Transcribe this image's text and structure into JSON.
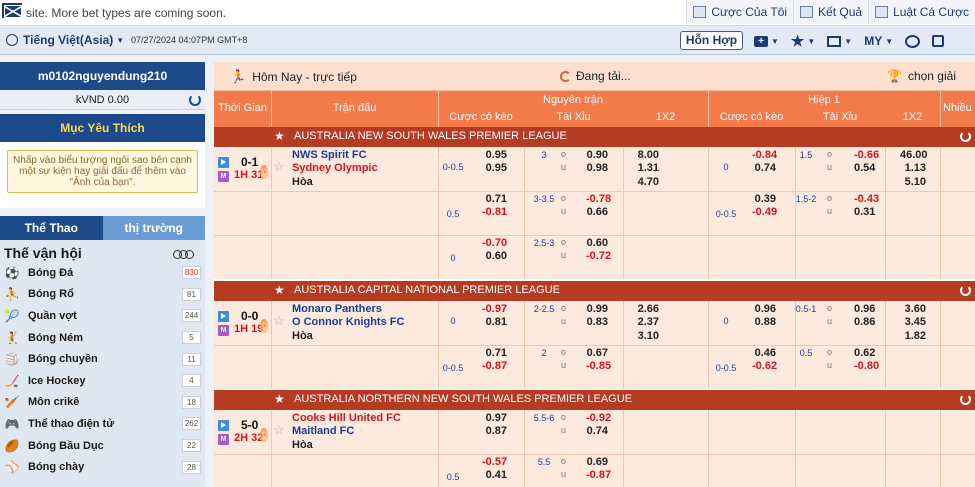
{
  "topbar": {
    "marquee": "site. More bet types are coming soon.",
    "nav": [
      "Cược Của Tôi",
      "Kết Quả",
      "Luật Cá Cược"
    ]
  },
  "bar2": {
    "language": "Tiếng Việt(Asia)",
    "datetime": "07/27/2024 04:07PM GMT+8",
    "mode_button": "Hỗn Hợp",
    "my_label": "MY"
  },
  "sidebar": {
    "username": "m0102nguyendung210",
    "credit": "kVND 0.00",
    "fav_title": "Mục Yêu Thích",
    "fav_hint": "Nhấp vào biểu tượng ngôi sao bên cạnh một sự kiện hay giải đấu để thêm vào \"Ảnh của bạn\".",
    "tab_sports": "Thể Thao",
    "tab_market": "thị trường",
    "olympics": "Thế vận hội",
    "sports": [
      {
        "name": "Bóng Đá",
        "count": "830",
        "icon": "⚽"
      },
      {
        "name": "Bóng Rổ",
        "count": "81",
        "icon": "⛹"
      },
      {
        "name": "Quần vợt",
        "count": "244",
        "icon": "🎾"
      },
      {
        "name": "Bóng Ném",
        "count": "5",
        "icon": "🤾"
      },
      {
        "name": "Bóng chuyền",
        "count": "11",
        "icon": "🏐"
      },
      {
        "name": "Ice Hockey",
        "count": "4",
        "icon": "🏒"
      },
      {
        "name": "Môn crikê",
        "count": "18",
        "icon": "🏏"
      },
      {
        "name": "Thể thao điện tử",
        "count": "262",
        "icon": "🎮"
      },
      {
        "name": "Bóng Bầu Dục",
        "count": "22",
        "icon": "🏉"
      },
      {
        "name": "Bóng chày",
        "count": "28",
        "icon": "⚾"
      }
    ]
  },
  "main": {
    "header_left": "Hôm Nay - trực tiếp",
    "header_center": "Đang tải...",
    "header_right": "chọn giải",
    "columns": {
      "time": "Thời Gian",
      "match": "Trận đấu",
      "full": "Nguyên trận",
      "half": "Hiệp 1",
      "hdp": "Cược có kèo",
      "ou": "Tài Xỉu",
      "x12": "1X2",
      "more": "Nhiều"
    },
    "leagues": [
      "AUSTRALIA NEW SOUTH WALES PREMIER LEAGUE",
      "AUSTRALIA CAPITAL NATIONAL PREMIER LEAGUE",
      "AUSTRALIA NORTHERN NEW SOUTH WALES PREMIER LEAGUE"
    ],
    "matches": [
      {
        "score": "0-1",
        "time": "1H 31'",
        "home": "NWS Spirit FC",
        "away": "Sydney Olympic",
        "draw": "Hòa",
        "lines": [
          {
            "hdp": "0-0.5",
            "h1": "0.95",
            "h2": "0.95",
            "ou": "3",
            "o1": "0.90",
            "o2": "0.98",
            "x1": "8.00",
            "x2": "1.31",
            "x3": "4.70",
            "fhdp": "0",
            "f1": "-0.84",
            "f2": "0.74",
            "fou": "1.5",
            "fo1": "-0.66",
            "fo2": "0.54",
            "fx1": "46.00",
            "fx2": "1.13",
            "fx3": "5.10"
          },
          {
            "hdp": "0.5",
            "h1": "0.71",
            "h2": "-0.81",
            "ou": "3-3.5",
            "o1": "-0.78",
            "o2": "0.66",
            "fhdp": "0-0.5",
            "f1": "0.39",
            "f2": "-0.49",
            "fou": "1.5-2",
            "fo1": "-0.43",
            "fo2": "0.31"
          },
          {
            "hdp": "0",
            "h1": "-0.70",
            "h2": "0.60",
            "ou": "2.5-3",
            "o1": "0.60",
            "o2": "-0.72"
          }
        ]
      },
      {
        "score": "0-0",
        "time": "1H 19'",
        "home": "Monaro Panthers",
        "away": "O Connor Knights FC",
        "draw": "Hòa",
        "lines": [
          {
            "hdp": "0",
            "h1": "-0.97",
            "h2": "0.81",
            "ou": "2-2.5",
            "o1": "0.99",
            "o2": "0.83",
            "x1": "2.66",
            "x2": "2.37",
            "x3": "3.10",
            "fhdp": "0",
            "f1": "0.96",
            "f2": "0.88",
            "fou": "0.5-1",
            "fo1": "0.96",
            "fo2": "0.86",
            "fx1": "3.60",
            "fx2": "3.45",
            "fx3": "1.82"
          },
          {
            "hdp": "0-0.5",
            "h1": "0.71",
            "h2": "-0.87",
            "ou": "2",
            "o1": "0.67",
            "o2": "-0.85",
            "fhdp": "0-0.5",
            "f1": "0.46",
            "f2": "-0.62",
            "fou": "0.5",
            "fo1": "0.62",
            "fo2": "-0.80"
          }
        ]
      },
      {
        "score": "5-0",
        "time": "2H 32'",
        "home": "Cooks Hill United FC",
        "away": "Maitland FC",
        "draw": "Hòa",
        "lines": [
          {
            "hdp": "",
            "h1": "0.97",
            "h2": "0.87",
            "ou": "5.5-6",
            "o1": "-0.92",
            "o2": "0.74"
          },
          {
            "hdp": "0.5",
            "h1": "-0.57",
            "h2": "0.41",
            "ou": "5.5",
            "o1": "0.69",
            "o2": "-0.87"
          }
        ]
      }
    ],
    "ou_over": "o",
    "ou_under": "u"
  }
}
